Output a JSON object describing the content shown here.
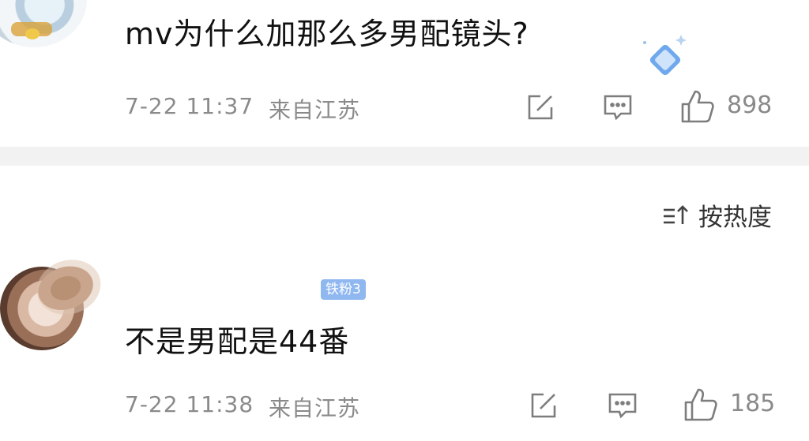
{
  "comments": [
    {
      "text": "mv为什么加那么多男配镜头?",
      "timestamp": "7-22 11:37",
      "location": "来自江苏",
      "likes": "898"
    },
    {
      "badge": "铁粉3",
      "text": "不是男配是44番",
      "timestamp": "7-22 11:38",
      "location": "来自江苏",
      "likes": "185"
    }
  ],
  "sort": {
    "label": "按热度"
  },
  "icons": {
    "share": "share-icon",
    "reply": "comment-icon",
    "like": "thumbs-up-icon",
    "sort": "sort-icon",
    "decoration": "diamond-icon"
  },
  "colors": {
    "badge": "#8fb7f0",
    "meta": "#8a8a8a",
    "divider": "#f2f2f2"
  }
}
